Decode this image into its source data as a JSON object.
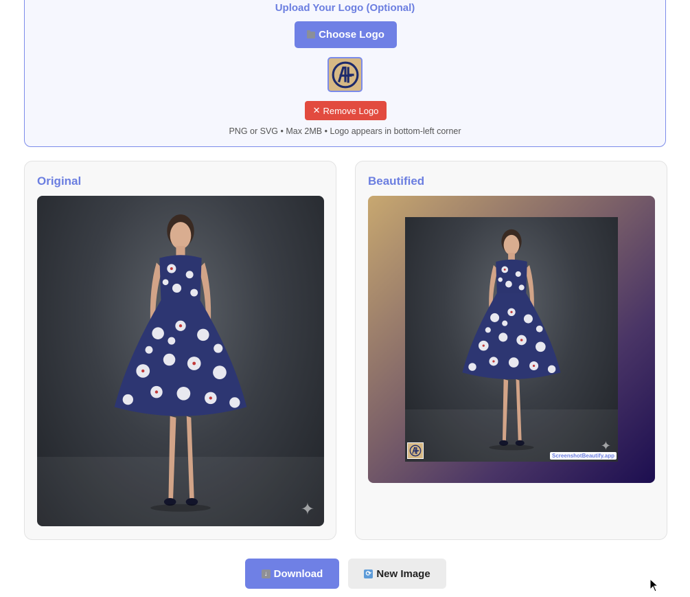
{
  "upload": {
    "title": "Upload Your Logo (Optional)",
    "choose_label": "Choose Logo",
    "remove_label": "Remove Logo",
    "remove_symbol": "✕",
    "hint": "PNG or SVG • Max 2MB • Logo appears in bottom-left corner"
  },
  "original": {
    "title": "Original"
  },
  "beautified": {
    "title": "Beautified",
    "watermark": "ScreenshotBeautify.app"
  },
  "actions": {
    "download_label": "Download",
    "new_image_label": "New Image"
  },
  "icons": {
    "choose": "folder-icon",
    "download": "download-icon",
    "new_image": "refresh-icon",
    "sparkle": "sparkle-icon"
  },
  "colors": {
    "accent": "#6f80e5",
    "danger": "#e24b3f",
    "logo_bg": "#d7b985",
    "logo_fg": "#1d2a6b"
  }
}
